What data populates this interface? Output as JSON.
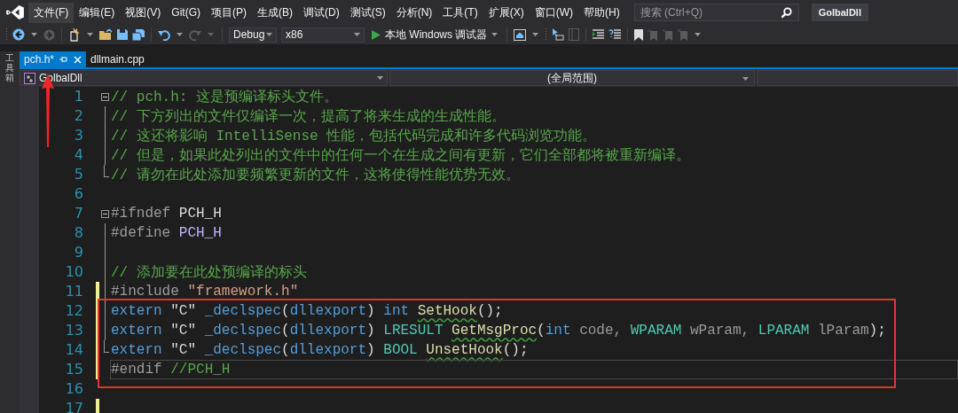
{
  "menu": {
    "items": [
      {
        "label": "文件(F)",
        "selected": true
      },
      {
        "label": "编辑(E)",
        "selected": false
      },
      {
        "label": "视图(V)",
        "selected": false
      },
      {
        "label": "Git(G)",
        "selected": false
      },
      {
        "label": "项目(P)",
        "selected": false
      },
      {
        "label": "生成(B)",
        "selected": false
      },
      {
        "label": "调试(D)",
        "selected": false
      },
      {
        "label": "测试(S)",
        "selected": false
      },
      {
        "label": "分析(N)",
        "selected": false
      },
      {
        "label": "工具(T)",
        "selected": false
      },
      {
        "label": "扩展(X)",
        "selected": false
      },
      {
        "label": "窗口(W)",
        "selected": false
      },
      {
        "label": "帮助(H)",
        "selected": false
      }
    ]
  },
  "search": {
    "placeholder": "搜索 (Ctrl+Q)"
  },
  "solution_name": "GolbalDll",
  "toolbar": {
    "configuration": "Debug",
    "platform": "x86",
    "run_label": "本地 Windows 调试器"
  },
  "tool_strip": {
    "label": "工具箱"
  },
  "tabs": [
    {
      "label": "pch.h*",
      "selected": true
    },
    {
      "label": "dllmain.cpp",
      "selected": false
    }
  ],
  "nav_bar": {
    "project": "GolbalDll",
    "scope": "(全局范围)"
  },
  "editor": {
    "lines": [
      {
        "number": "1",
        "changed": false,
        "kind": "foldstart",
        "current": false,
        "tokens": [
          {
            "text": "// pch.h: 这是预编译标头文件。",
            "kind": "comment"
          }
        ]
      },
      {
        "number": "2",
        "changed": false,
        "kind": "foldbody",
        "current": false,
        "tokens": [
          {
            "text": "// 下方列出的文件仅编译一次，提高了将来生成的生成性能。",
            "kind": "comment"
          }
        ]
      },
      {
        "number": "3",
        "changed": false,
        "kind": "foldbody",
        "current": false,
        "tokens": [
          {
            "text": "// 这还将影响 IntelliSense 性能，包括代码完成和许多代码浏览功能。",
            "kind": "comment"
          }
        ]
      },
      {
        "number": "4",
        "changed": false,
        "kind": "foldbody",
        "current": false,
        "tokens": [
          {
            "text": "// 但是，如果此处列出的文件中的任何一个在生成之间有更新，它们全部都将被重新编译。",
            "kind": "comment"
          }
        ]
      },
      {
        "number": "5",
        "changed": false,
        "kind": "foldend",
        "current": false,
        "tokens": [
          {
            "text": "// 请勿在此处添加要频繁更新的文件，这将使得性能优势无效。",
            "kind": "comment"
          }
        ]
      },
      {
        "number": "6",
        "changed": false,
        "kind": "plain",
        "current": false
      },
      {
        "number": "7",
        "changed": false,
        "kind": "foldstart",
        "current": false,
        "tokens": [
          {
            "text": "#ifndef ",
            "kind": "preproc"
          },
          {
            "text": "PCH_H",
            "kind": "plain"
          }
        ]
      },
      {
        "number": "8",
        "changed": false,
        "kind": "foldbody",
        "current": false,
        "tokens": [
          {
            "text": "#define ",
            "kind": "preproc"
          },
          {
            "text": "PCH_H",
            "kind": "macro"
          }
        ]
      },
      {
        "number": "9",
        "changed": false,
        "kind": "foldbody",
        "current": false
      },
      {
        "number": "10",
        "changed": false,
        "kind": "foldbody",
        "current": false,
        "tokens": [
          {
            "text": "// 添加要在此处预编译的标头",
            "kind": "comment"
          }
        ]
      },
      {
        "number": "11",
        "changed": true,
        "kind": "foldbody",
        "current": false,
        "tokens": [
          {
            "text": "#include ",
            "kind": "preproc"
          },
          {
            "text": "\"framework.h\"",
            "kind": "string"
          }
        ]
      },
      {
        "number": "12",
        "changed": true,
        "kind": "foldbody",
        "current": false,
        "tokens": [
          {
            "text": "extern",
            "kind": "keyword"
          },
          {
            "text": " \"C\" ",
            "kind": "plain"
          },
          {
            "text": "_declspec",
            "kind": "keyword"
          },
          {
            "text": "(",
            "kind": "plain"
          },
          {
            "text": "dllexport",
            "kind": "keyword"
          },
          {
            "text": ") ",
            "kind": "plain"
          },
          {
            "text": "int ",
            "kind": "keyword"
          },
          {
            "text": "SetHook",
            "kind": "unresolved"
          },
          {
            "text": "();",
            "kind": "plain"
          }
        ]
      },
      {
        "number": "13",
        "changed": true,
        "kind": "foldbody",
        "current": false,
        "tokens": [
          {
            "text": "extern",
            "kind": "keyword"
          },
          {
            "text": " \"C\" ",
            "kind": "plain"
          },
          {
            "text": "_declspec",
            "kind": "keyword"
          },
          {
            "text": "(",
            "kind": "plain"
          },
          {
            "text": "dllexport",
            "kind": "keyword"
          },
          {
            "text": ") ",
            "kind": "plain"
          },
          {
            "text": "LRESULT ",
            "kind": "type"
          },
          {
            "text": "GetMsgProc",
            "kind": "unresolved"
          },
          {
            "text": "(",
            "kind": "plain"
          },
          {
            "text": "int",
            "kind": "keyword"
          },
          {
            "text": " code, ",
            "kind": "param"
          },
          {
            "text": "WPARAM",
            "kind": "type"
          },
          {
            "text": " wParam, ",
            "kind": "param"
          },
          {
            "text": "LPARAM",
            "kind": "type"
          },
          {
            "text": " lParam",
            "kind": "param"
          },
          {
            "text": ");",
            "kind": "plain"
          }
        ]
      },
      {
        "number": "14",
        "changed": true,
        "kind": "foldend",
        "current": false,
        "tokens": [
          {
            "text": "extern",
            "kind": "keyword"
          },
          {
            "text": " \"C\" ",
            "kind": "plain"
          },
          {
            "text": "_declspec",
            "kind": "keyword"
          },
          {
            "text": "(",
            "kind": "plain"
          },
          {
            "text": "dllexport",
            "kind": "keyword"
          },
          {
            "text": ") ",
            "kind": "plain"
          },
          {
            "text": "BOOL ",
            "kind": "type"
          },
          {
            "text": "UnsetHook",
            "kind": "unresolved"
          },
          {
            "text": "();",
            "kind": "plain"
          }
        ]
      },
      {
        "number": "15",
        "changed": true,
        "kind": "plain",
        "current": true,
        "tokens": [
          {
            "text": "#endif ",
            "kind": "preproc"
          },
          {
            "text": "//PCH_H",
            "kind": "comment"
          }
        ]
      },
      {
        "number": "16",
        "changed": false,
        "kind": "plain",
        "current": false
      },
      {
        "number": "17",
        "changed": true,
        "kind": "plain",
        "current": false
      }
    ]
  }
}
